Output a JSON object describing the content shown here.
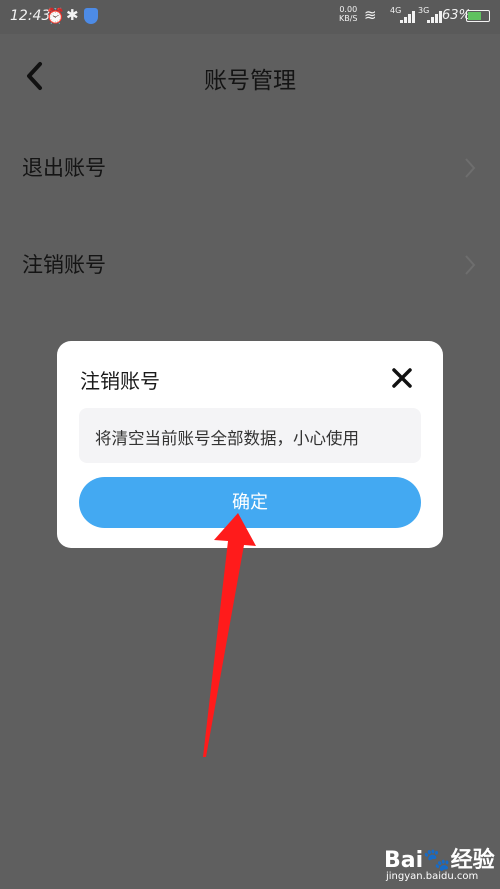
{
  "status_bar": {
    "time": "12:43",
    "net_speed_value": "0.00",
    "net_speed_unit": "KB/S",
    "net1": "4G",
    "net2": "3G",
    "battery_pct": "63%",
    "battery_level": 0.63
  },
  "header": {
    "title": "账号管理",
    "back_icon": "chevron-left-icon"
  },
  "menu": {
    "items": [
      {
        "label": "退出账号",
        "icon": "chevron-right-icon"
      },
      {
        "label": "注销账号",
        "icon": "chevron-right-icon"
      }
    ]
  },
  "dialog": {
    "title": "注销账号",
    "close_icon": "close-icon",
    "message": "将清空当前账号全部数据，小心使用",
    "confirm_label": "确定"
  },
  "annotation": {
    "type": "red-arrow",
    "color": "#ff1b1b"
  },
  "watermark": {
    "brand": "Bai",
    "brand_suffix": "经验",
    "url": "jingyan.baidu.com"
  },
  "colors": {
    "overlay_background": "#5f5f5f",
    "confirm_button": "#43a9f2",
    "arrow": "#ff1b1b"
  }
}
